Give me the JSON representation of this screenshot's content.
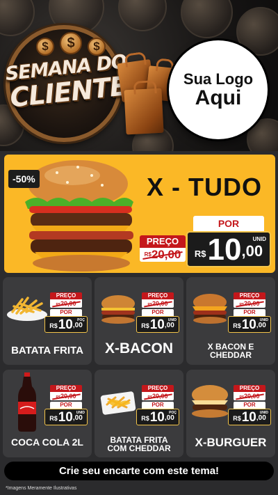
{
  "header": {
    "campaign_line1": "SEMANA DO",
    "campaign_line2": "CLIENTE",
    "currency_symbol": "$",
    "logo_line1": "Sua Logo",
    "logo_line2": "Aqui"
  },
  "hero": {
    "discount": "-50%",
    "title": "X - TUDO",
    "preco_label": "PREÇO",
    "old_currency": "R$",
    "old_price": "20,00",
    "por_label": "POR",
    "unit": "UNID",
    "new_currency": "R$",
    "new_int": "10",
    "new_dec": ",00"
  },
  "products": [
    {
      "name": "BATATA FRITA",
      "preco_label": "PREÇO",
      "old_currency": "R$",
      "old_price": "20,00",
      "por_label": "POR",
      "currency": "R$",
      "int": "10",
      "dec": ",00",
      "unit": "POÇ"
    },
    {
      "name": "X-BACON",
      "preco_label": "PREÇO",
      "old_currency": "R$",
      "old_price": "20,00",
      "por_label": "POR",
      "currency": "R$",
      "int": "10",
      "dec": ",00",
      "unit": "UNID"
    },
    {
      "name_line1": "X BACON E",
      "name_line2": "CHEDDAR",
      "preco_label": "PREÇO",
      "old_currency": "R$",
      "old_price": "20,00",
      "por_label": "POR",
      "currency": "R$",
      "int": "10",
      "dec": ",00",
      "unit": "UNID"
    },
    {
      "name": "COCA COLA 2L",
      "preco_label": "PREÇO",
      "old_currency": "R$",
      "old_price": "20,00",
      "por_label": "POR",
      "currency": "R$",
      "int": "10",
      "dec": ",00",
      "unit": "UNID"
    },
    {
      "name_line1": "BATATA FRITA",
      "name_line2": "COM CHEDDAR",
      "preco_label": "PREÇO",
      "old_currency": "R$",
      "old_price": "20,00",
      "por_label": "POR",
      "currency": "R$",
      "int": "10",
      "dec": ",00",
      "unit": "POÇ"
    },
    {
      "name": "X-BURGUER",
      "preco_label": "PREÇO",
      "old_currency": "R$",
      "old_price": "20,00",
      "por_label": "POR",
      "currency": "R$",
      "int": "10",
      "dec": ",00",
      "unit": "UNID"
    }
  ],
  "footer": {
    "cta": "Crie seu encarte com este tema!",
    "disclaimer": "*Imagens Meramente Ilustrativas"
  },
  "colors": {
    "background": "#2b2b2d",
    "hero_yellow": "#fbb826",
    "price_red": "#c4171b",
    "card": "#3b3b3d",
    "gold_border": "#f4c54a"
  }
}
